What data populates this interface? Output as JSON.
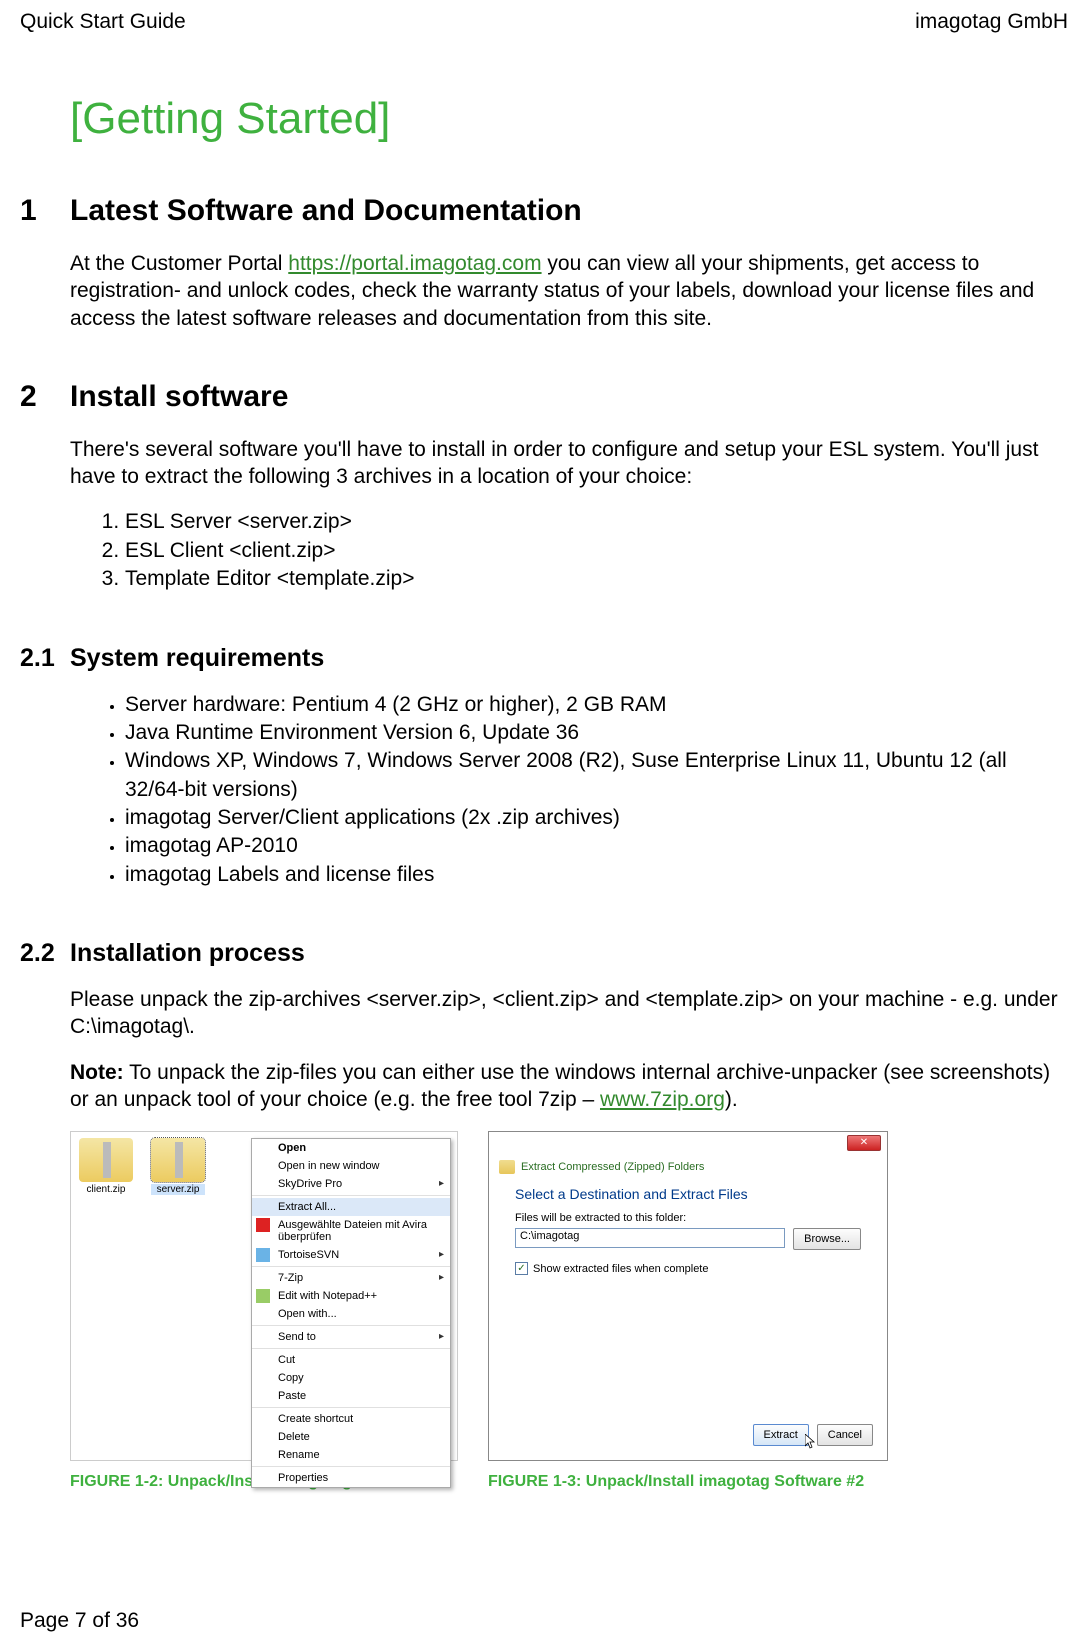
{
  "header": {
    "left": "Quick Start Guide",
    "right": "imagotag GmbH"
  },
  "chapter": "[Getting Started]",
  "sections": {
    "s1": {
      "num": "1",
      "title": "Latest Software and Documentation",
      "p1a": "At the Customer Portal ",
      "link1": "https://portal.imagotag.com",
      "p1b": " you can view all your shipments, get access to registration- and unlock codes, check the warranty status of your labels, download your license files and access the latest software releases and documentation from this site."
    },
    "s2": {
      "num": "2",
      "title": "Install software",
      "p1": "There's several software you'll have to install in order to configure and setup your ESL system. You'll just have to extract the following 3 archives in a location of your choice:",
      "ol": [
        "ESL Server <server.zip>",
        "ESL Client <client.zip>",
        "Template Editor <template.zip>"
      ]
    },
    "s21": {
      "num": "2.1",
      "title": "System requirements",
      "ul": [
        "Server hardware: Pentium 4 (2 GHz or higher), 2 GB RAM",
        "Java Runtime Environment Version 6, Update 36",
        "Windows XP, Windows 7, Windows Server 2008 (R2), Suse Enterprise Linux 11, Ubuntu 12 (all 32/64-bit versions)",
        "imagotag Server/Client applications (2x .zip archives)",
        "imagotag AP-2010",
        "imagotag Labels and license files"
      ]
    },
    "s22": {
      "num": "2.2",
      "title": "Installation process",
      "p1": "Please unpack the zip-archives <server.zip>, <client.zip> and <template.zip> on your machine - e.g. under C:\\imagotag\\.",
      "note_label": "Note:",
      "p2a": " To unpack the zip-files you can either use the windows internal archive-unpacker (see screenshots) or an unpack tool of your choice (e.g. the free tool 7zip – ",
      "link2": "www.7zip.org",
      "p2b": ")."
    }
  },
  "fig1": {
    "caption": "FIGURE 1-2: Unpack/Install imagotag Software",
    "icons": {
      "client": "client.zip",
      "server": "server.zip"
    },
    "menu": {
      "open": "Open",
      "open_new": "Open in new window",
      "skydrive": "SkyDrive Pro",
      "extract": "Extract All...",
      "avira": "Ausgewählte Dateien mit Avira überprüfen",
      "tortoise": "TortoiseSVN",
      "sevenzip": "7-Zip",
      "notepadpp": "Edit with Notepad++",
      "openwith": "Open with...",
      "sendto": "Send to",
      "cut": "Cut",
      "copy": "Copy",
      "paste": "Paste",
      "shortcut": "Create shortcut",
      "delete": "Delete",
      "rename": "Rename",
      "properties": "Properties"
    }
  },
  "fig2": {
    "caption": "FIGURE 1-3: Unpack/Install imagotag Software #2",
    "crumb": "Extract Compressed (Zipped) Folders",
    "heading": "Select a Destination and Extract Files",
    "label": "Files will be extracted to this folder:",
    "path": "C:\\imagotag",
    "browse": "Browse...",
    "show": "Show extracted files when complete",
    "extract_btn": "Extract",
    "cancel_btn": "Cancel"
  },
  "footer": "Page 7 of 36"
}
